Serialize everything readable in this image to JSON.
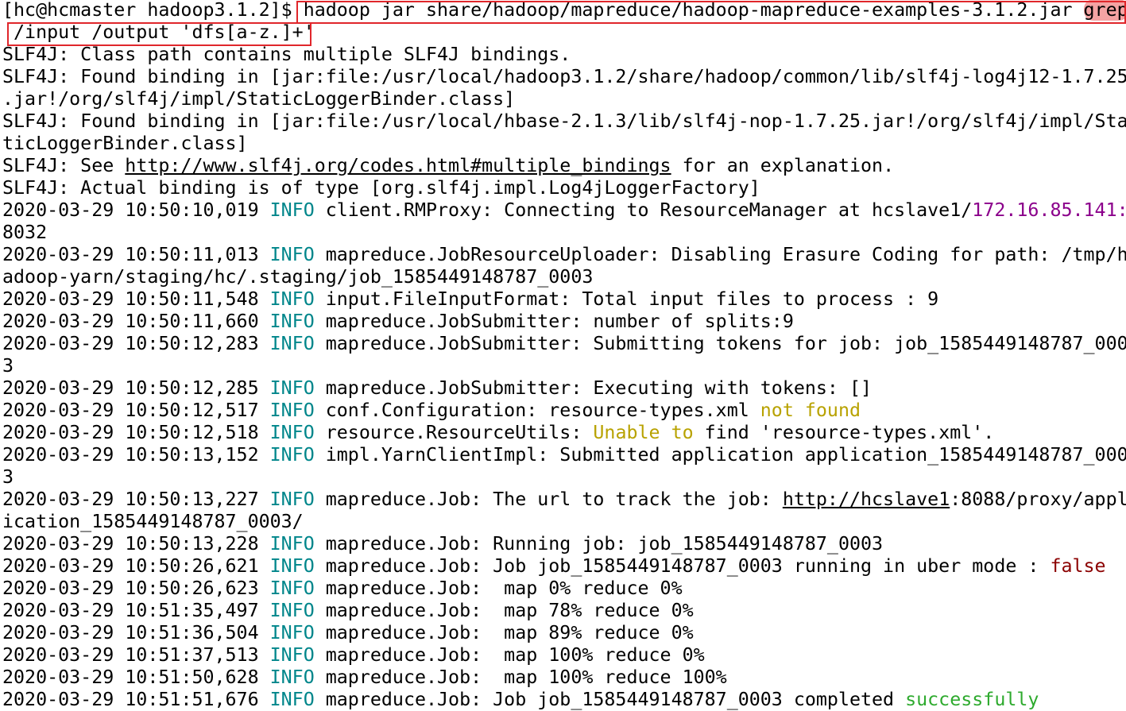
{
  "prompt": "[hc@hcmaster hadoop3.1.2]$ ",
  "command_part1": "hadoop jar share/hadoop/mapreduce/hadoop-mapreduce-examples-3.1.2.jar ",
  "command_grep": "grep",
  "command_part2": " /input /output 'dfs[a-z.]+'",
  "slf4j": {
    "l1": "SLF4J: Class path contains multiple SLF4J bindings.",
    "l2": "SLF4J: Found binding in [jar:file:/usr/local/hadoop3.1.2/share/hadoop/common/lib/slf4j-log4j12-1.7.25",
    "l3": ".jar!/org/slf4j/impl/StaticLoggerBinder.class]",
    "l4": "SLF4J: Found binding in [jar:file:/usr/local/hbase-2.1.3/lib/slf4j-nop-1.7.25.jar!/org/slf4j/impl/Sta",
    "l5": "ticLoggerBinder.class]",
    "l6_pre": "SLF4J: See ",
    "l6_link": "http://www.slf4j.org/codes.html#multiple_bindings",
    "l6_post": " for an explanation.",
    "l7": "SLF4J: Actual binding is of type [org.slf4j.impl.Log4jLoggerFactory]"
  },
  "info_label": "INFO",
  "log": [
    {
      "ts": "2020-03-29 10:50:10,019",
      "msg": " client.RMProxy: Connecting to ResourceManager at hcslave1/",
      "ip": "172.16.85.141:",
      "cont": "8032"
    },
    {
      "ts": "2020-03-29 10:50:11,013",
      "msg": " mapreduce.JobResourceUploader: Disabling Erasure Coding for path: /tmp/h",
      "cont": "adoop-yarn/staging/hc/.staging/job_1585449148787_0003"
    },
    {
      "ts": "2020-03-29 10:50:11,548",
      "msg": " input.FileInputFormat: Total input files to process : 9"
    },
    {
      "ts": "2020-03-29 10:50:11,660",
      "msg": " mapreduce.JobSubmitter: number of splits:9"
    },
    {
      "ts": "2020-03-29 10:50:12,283",
      "msg": " mapreduce.JobSubmitter: Submitting tokens for job: job_1585449148787_000",
      "cont": "3"
    },
    {
      "ts": "2020-03-29 10:50:12,285",
      "msg": " mapreduce.JobSubmitter: Executing with tokens: []"
    },
    {
      "ts": "2020-03-29 10:50:12,517",
      "msg": " conf.Configuration: resource-types.xml ",
      "warn": "not found"
    },
    {
      "ts": "2020-03-29 10:50:12,518",
      "msg": " resource.ResourceUtils: ",
      "warn": "Unable to",
      "msg2": " find 'resource-types.xml'."
    },
    {
      "ts": "2020-03-29 10:50:13,152",
      "msg": " impl.YarnClientImpl: Submitted application application_1585449148787_000",
      "cont": "3"
    },
    {
      "ts": "2020-03-29 10:50:13,227",
      "msg": " mapreduce.Job: The url to track the job: ",
      "link": "http://hcslave1",
      "msg2": ":8088/proxy/appl",
      "cont": "ication_1585449148787_0003/"
    },
    {
      "ts": "2020-03-29 10:50:13,228",
      "msg": " mapreduce.Job: Running job: job_1585449148787_0003"
    },
    {
      "ts": "2020-03-29 10:50:26,621",
      "msg": " mapreduce.Job: Job job_1585449148787_0003 running in uber mode : ",
      "bad": "false"
    },
    {
      "ts": "2020-03-29 10:50:26,623",
      "msg": " mapreduce.Job:  map 0% reduce 0%"
    },
    {
      "ts": "2020-03-29 10:51:35,497",
      "msg": " mapreduce.Job:  map 78% reduce 0%"
    },
    {
      "ts": "2020-03-29 10:51:36,504",
      "msg": " mapreduce.Job:  map 89% reduce 0%"
    },
    {
      "ts": "2020-03-29 10:51:37,513",
      "msg": " mapreduce.Job:  map 100% reduce 0%"
    },
    {
      "ts": "2020-03-29 10:51:50,628",
      "msg": " mapreduce.Job:  map 100% reduce 100%"
    },
    {
      "ts": "2020-03-29 10:51:51,676",
      "msg": " mapreduce.Job: Job job_1585449148787_0003 completed ",
      "ok": "successfully"
    }
  ],
  "colors": {
    "info": "#00868b",
    "ip": "#8b008b",
    "warning": "#b8a200",
    "false": "#8b0000",
    "success": "#2eaa2e",
    "highlight_box": "#e0262b"
  }
}
